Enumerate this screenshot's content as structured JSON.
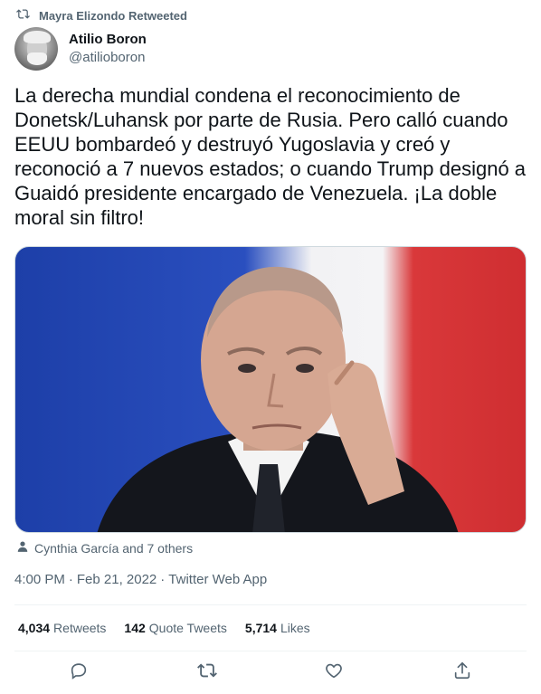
{
  "retweet_banner": {
    "text": "Mayra Elizondo Retweeted",
    "icon": "retweet-icon"
  },
  "author": {
    "display_name": "Atilio Boron",
    "handle": "@atilioboron"
  },
  "tweet": {
    "text": "La derecha mundial condena el reconocimiento de Donetsk/Luhansk por parte de Rusia. Pero calló cuando EEUU bombardeó y destruyó Yugoslavia y creó y reconoció a 7 nuevos estados; o cuando Trump designó a Guaidó presidente encargado de Venezuela. ¡La doble moral sin filtro!"
  },
  "media": {
    "tagged_people": "Cynthia García and 7 others",
    "flag_colors": [
      "#2a4fbf",
      "#f2f2f4",
      "#d9383a"
    ]
  },
  "meta": {
    "time": "4:00 PM",
    "separator": "·",
    "date": "Feb 21, 2022",
    "source": "Twitter Web App"
  },
  "stats": {
    "retweets_count": "4,034",
    "retweets_label": "Retweets",
    "quotes_count": "142",
    "quotes_label": "Quote Tweets",
    "likes_count": "5,714",
    "likes_label": "Likes"
  },
  "actions": [
    "reply-icon",
    "retweet-icon",
    "like-icon",
    "share-icon"
  ],
  "colors": {
    "secondary_text": "#536471",
    "divider": "#eff3f4",
    "primary_text": "#0f1419"
  }
}
